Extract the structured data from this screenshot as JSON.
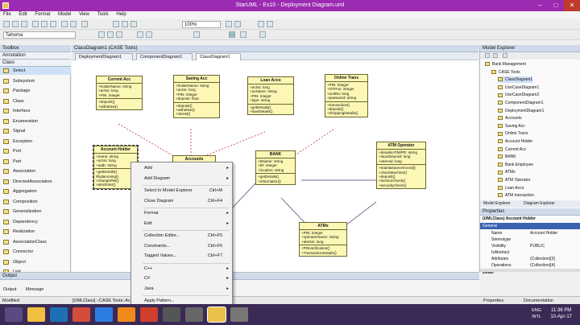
{
  "window": {
    "title": "StarUML - Ex10 - Deployment Diagram.uml",
    "min": "–",
    "max": "□",
    "close": "✕"
  },
  "menu": [
    "File",
    "Edit",
    "Format",
    "Model",
    "View",
    "Tools",
    "Help"
  ],
  "toolbar": {
    "font_name": "Tahoma",
    "zoom": "100%"
  },
  "toolbox": {
    "title": "Toolbox",
    "annotation_label": "Annotation",
    "class_label": "Class",
    "items": [
      "Select",
      "Subsystem",
      "Package",
      "Class",
      "Interface",
      "Enumeration",
      "Signal",
      "Exception",
      "Port",
      "Part",
      "Association",
      "DirectedAssociation",
      "Aggregation",
      "Composition",
      "Generalization",
      "Dependency",
      "Realization",
      "AssociationClass",
      "Connector",
      "Object",
      "Link"
    ]
  },
  "doc_title": "ClassDiagram1 (CASE Tools)",
  "tabs": [
    "DeploymentDiagram1",
    "ComponentDiagram1",
    "ClassDiagram1"
  ],
  "classes": [
    {
      "name": "Current Acc",
      "attrs": [
        "+holderName: string",
        "+acNo: long",
        "+PIN: integer"
      ],
      "ops": [
        "+deposit()",
        "+withdraw()"
      ]
    },
    {
      "name": "Saving Acc",
      "attrs": [
        "+holderName: string",
        "+acNo: long",
        "+PIN: integer",
        "+deposit: float"
      ],
      "ops": [
        "+deposit()",
        "+withdraw()",
        "+intrest()"
      ]
    },
    {
      "name": "Loan Acco",
      "attrs": [
        "+acNo: long",
        "+acName: string",
        "+PIN: integer",
        "+type: string"
      ],
      "ops": [
        "+getDetails()",
        "+loanDetails()"
      ]
    },
    {
      "name": "Online Trans",
      "attrs": [
        "+PIN: integer",
        "+OTPno: integer",
        "+unitNo: long",
        "+password: string"
      ],
      "ops": [
        "+transaction()",
        "+deposit()",
        "+shoppingDetails()"
      ]
    },
    {
      "name": "Account Holder",
      "attrs": [
        "+name: string",
        "+acNo: long",
        "+addr: string"
      ],
      "ops": [
        "+getDetails()",
        "#balanceInq()",
        "+changePIN()",
        "+atmEnter()"
      ]
    },
    {
      "name": "Accounts",
      "attrs": [],
      "ops": []
    },
    {
      "name": "BANK",
      "attrs": [
        "+bName: string",
        "+ID: integer",
        "+location: string"
      ],
      "ops": [
        "+getDetails()",
        "+Information()"
      ]
    },
    {
      "name": "ATM Operator",
      "attrs": [
        "+details/ATM/PR: string",
        "+inputDeposit: long",
        "+interval: long"
      ],
      "ops": [
        "+maintainance/ocord()",
        "+checkMachine()",
        "+deposit()",
        "+serviceCheck()",
        "+securityCheck()"
      ]
    },
    {
      "name": "ATMs",
      "attrs": [
        "+PIN: integer",
        "+operatorName: String",
        "+atmNo: long"
      ],
      "ops": [
        "+PINverification()",
        "+TransactionDetails()"
      ]
    }
  ],
  "context_menu": [
    {
      "label": "Add",
      "shortcut": "",
      "arrow": "▸"
    },
    {
      "label": "Add Diagram",
      "shortcut": "",
      "arrow": "▸"
    },
    {
      "label": "Select In Model Explorer",
      "shortcut": "Ctrl+M",
      "arrow": ""
    },
    {
      "label": "Close Diagram",
      "shortcut": "Ctrl+F4",
      "arrow": ""
    },
    {
      "label": "Format",
      "shortcut": "",
      "arrow": "▸"
    },
    {
      "label": "Edit",
      "shortcut": "",
      "arrow": "▸"
    },
    {
      "label": "Collection Editor...",
      "shortcut": "Ctrl+F5",
      "arrow": ""
    },
    {
      "label": "Constraints...",
      "shortcut": "Ctrl+F6",
      "arrow": ""
    },
    {
      "label": "Tagged Values...",
      "shortcut": "Ctrl+F7",
      "arrow": ""
    },
    {
      "label": "C++",
      "shortcut": "",
      "arrow": "▸"
    },
    {
      "label": "C#",
      "shortcut": "",
      "arrow": "▸"
    },
    {
      "label": "Java",
      "shortcut": "",
      "arrow": "▸"
    },
    {
      "label": "Apply Pattern...",
      "shortcut": "",
      "arrow": ""
    }
  ],
  "model_explorer": {
    "title": "Model Explorer",
    "items": [
      "Bank Management",
      "CASE Tools",
      "ClassDiagram1",
      "UseCaseDiagram1",
      "UseCaseDiagram2",
      "ComponentDiagram1",
      "DeploymentDiagram1",
      "Accounts",
      "Saving Acc",
      "Online Trans",
      "Account Holder",
      "Current Acc",
      "BANK",
      "Bank Employee",
      "ATMs",
      "ATM Operator",
      "Loan Acco",
      "ATM transaction"
    ],
    "tabs": [
      "Model Explorer",
      "Diagram Explorer"
    ]
  },
  "properties": {
    "title": "Properties",
    "header": "(UMLClass) Account Holder",
    "section": "General",
    "rows": [
      {
        "k": "Name",
        "v": "Account Holder"
      },
      {
        "k": "Stereotype",
        "v": ""
      },
      {
        "k": "Visibility",
        "v": "PUBLIC"
      },
      {
        "k": "IsAbstract",
        "v": ""
      },
      {
        "k": "Attributes",
        "v": "(Collection)[3]"
      },
      {
        "k": "Operations",
        "v": "(Collection)[4]"
      }
    ],
    "detail": "Detail",
    "tabs": [
      "Properties",
      "Documentation"
    ]
  },
  "output": {
    "title": "Output",
    "tabs": [
      "Output",
      "Message"
    ]
  },
  "status": {
    "left": "Modified",
    "class_path": "[UMLClass] ::CASE Tools::Account Holder"
  },
  "taskbar": {
    "lang": "ENG",
    "lang2": "INTL",
    "time": "11:36 PM",
    "date": "10-Apr-17"
  }
}
